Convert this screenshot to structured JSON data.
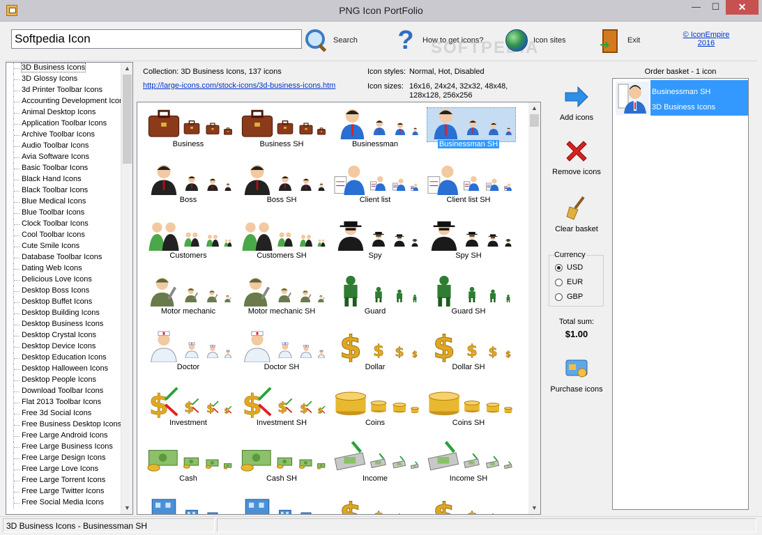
{
  "window": {
    "title": "PNG Icon PortFolio",
    "minimize": "—",
    "maximize": "☐",
    "close": "✕"
  },
  "toolbar": {
    "search_value": "Softpedia Icon",
    "search_label": "Search",
    "howto_label": "How to get icons?",
    "sites_label": "Icon sites",
    "exit_label": "Exit",
    "brand_line1": "© IconEmpire",
    "brand_line2": "2016",
    "watermark": "SOFTPEDIA"
  },
  "collections": [
    "3D Business Icons",
    "3D Glossy Icons",
    "3d Printer Toolbar Icons",
    "Accounting Development Icons",
    "Animal Desktop Icons",
    "Application Toolbar Icons",
    "Archive Toolbar Icons",
    "Audio Toolbar Icons",
    "Avia Software Icons",
    "Basic Toolbar Icons",
    "Black Hand Icons",
    "Black Toolbar Icons",
    "Blue Medical Icons",
    "Blue Toolbar Icons",
    "Clock Toolbar Icons",
    "Cool Toolbar Icons",
    "Cute Smile Icons",
    "Database Toolbar Icons",
    "Dating Web Icons",
    "Delicious Love Icons",
    "Desktop Boss Icons",
    "Desktop Buffet Icons",
    "Desktop Building Icons",
    "Desktop Business Icons",
    "Desktop Crystal Icons",
    "Desktop Device Icons",
    "Desktop Education Icons",
    "Desktop Halloween Icons",
    "Desktop People Icons",
    "Download Toolbar Icons",
    "Flat 2013 Toolbar Icons",
    "Free 3d Social Icons",
    "Free Business Desktop Icons",
    "Free Large Android Icons",
    "Free Large Business Icons",
    "Free Large Design Icons",
    "Free Large Love Icons",
    "Free Large Torrent Icons",
    "Free Large Twitter Icons",
    "Free Social Media Icons"
  ],
  "collection_info": {
    "collection_text": "Collection: 3D Business Icons, 137 icons",
    "url": "http://large-icons.com/stock-icons/3d-business-icons.htm",
    "styles_label": "Icon styles:",
    "styles_value": "Normal, Hot, Disabled",
    "sizes_label": "Icon sizes:",
    "sizes_line1": "16x16, 24x24, 32x32, 48x48,",
    "sizes_line2": "128x128, 256x256"
  },
  "icons": [
    {
      "name": "Business",
      "kind": "briefcase-icon"
    },
    {
      "name": "Business SH",
      "kind": "briefcase-icon"
    },
    {
      "name": "Businessman",
      "kind": "businessman-icon"
    },
    {
      "name": "Businessman SH",
      "kind": "businessman-icon",
      "selected": true
    },
    {
      "name": "Boss",
      "kind": "boss-icon"
    },
    {
      "name": "Boss SH",
      "kind": "boss-icon"
    },
    {
      "name": "Client list",
      "kind": "client-list-icon"
    },
    {
      "name": "Client list SH",
      "kind": "client-list-icon"
    },
    {
      "name": "Customers",
      "kind": "customers-icon"
    },
    {
      "name": "Customers SH",
      "kind": "customers-icon"
    },
    {
      "name": "Spy",
      "kind": "spy-icon"
    },
    {
      "name": "Spy SH",
      "kind": "spy-icon"
    },
    {
      "name": "Motor mechanic",
      "kind": "mechanic-icon"
    },
    {
      "name": "Motor mechanic SH",
      "kind": "mechanic-icon"
    },
    {
      "name": "Guard",
      "kind": "guard-icon"
    },
    {
      "name": "Guard SH",
      "kind": "guard-icon"
    },
    {
      "name": "Doctor",
      "kind": "doctor-icon"
    },
    {
      "name": "Doctor SH",
      "kind": "doctor-icon"
    },
    {
      "name": "Dollar",
      "kind": "dollar-icon"
    },
    {
      "name": "Dollar SH",
      "kind": "dollar-icon"
    },
    {
      "name": "Investment",
      "kind": "investment-icon"
    },
    {
      "name": "Investment SH",
      "kind": "investment-icon"
    },
    {
      "name": "Coins",
      "kind": "coins-icon"
    },
    {
      "name": "Coins SH",
      "kind": "coins-icon"
    },
    {
      "name": "Cash",
      "kind": "cash-icon"
    },
    {
      "name": "Cash SH",
      "kind": "cash-icon"
    },
    {
      "name": "Income",
      "kind": "income-icon"
    },
    {
      "name": "Income SH",
      "kind": "income-icon"
    },
    {
      "name": "",
      "kind": "building-icon"
    },
    {
      "name": "",
      "kind": "building-icon"
    },
    {
      "name": "",
      "kind": "dollar-icon"
    },
    {
      "name": "",
      "kind": "dollar-icon"
    }
  ],
  "actions": {
    "add": "Add icons",
    "remove": "Remove icons",
    "clear": "Clear basket",
    "currency_legend": "Currency",
    "currencies": [
      "USD",
      "EUR",
      "GBP"
    ],
    "selected_currency": "USD",
    "total_label": "Total sum:",
    "total_value": "$1.00",
    "purchase": "Purchase icons"
  },
  "basket": {
    "title": "Order basket - 1 icon",
    "item_name": "Businessman SH",
    "item_collection": "3D Business Icons"
  },
  "status": {
    "text": "3D Business Icons - Businessman SH"
  },
  "colors": {
    "selection": "#3399ff",
    "link": "#0033cc",
    "close": "#c75050"
  }
}
